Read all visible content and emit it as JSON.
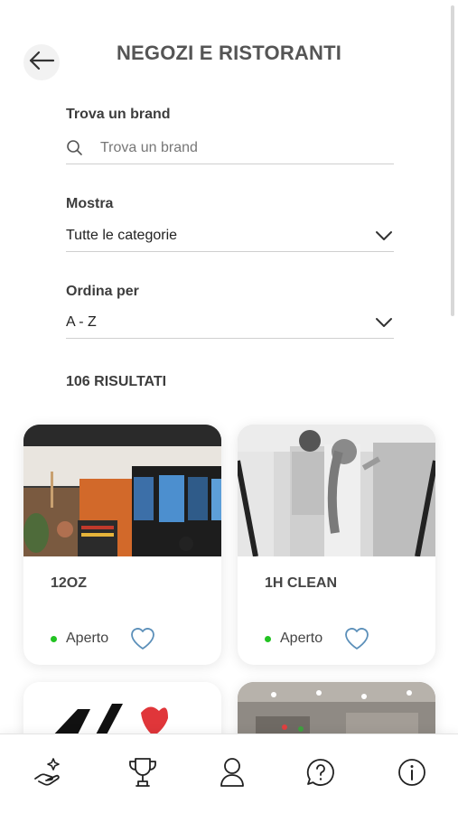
{
  "header": {
    "title": "NEGOZI E RISTORANTI",
    "back_icon": "arrow-left-icon"
  },
  "search": {
    "label": "Trova un brand",
    "placeholder": "Trova un brand"
  },
  "filter": {
    "label": "Mostra",
    "value": "Tutte le categorie"
  },
  "sort": {
    "label": "Ordina per",
    "value": "A - Z"
  },
  "results": {
    "count_text": "106 RISULTATI"
  },
  "cards": [
    {
      "name": "12OZ",
      "status": "Aperto",
      "status_color": "#22c322"
    },
    {
      "name": "1H CLEAN",
      "status": "Aperto",
      "status_color": "#22c322"
    },
    {
      "name": "",
      "status": ""
    },
    {
      "name": "",
      "status": ""
    }
  ],
  "bottom_nav": {
    "items": [
      {
        "icon": "hand-sparkle-icon"
      },
      {
        "icon": "trophy-icon"
      },
      {
        "icon": "user-icon"
      },
      {
        "icon": "help-icon"
      },
      {
        "icon": "info-icon"
      }
    ]
  },
  "colors": {
    "accent_blue": "#5b8fb9",
    "open_green": "#22c322"
  }
}
